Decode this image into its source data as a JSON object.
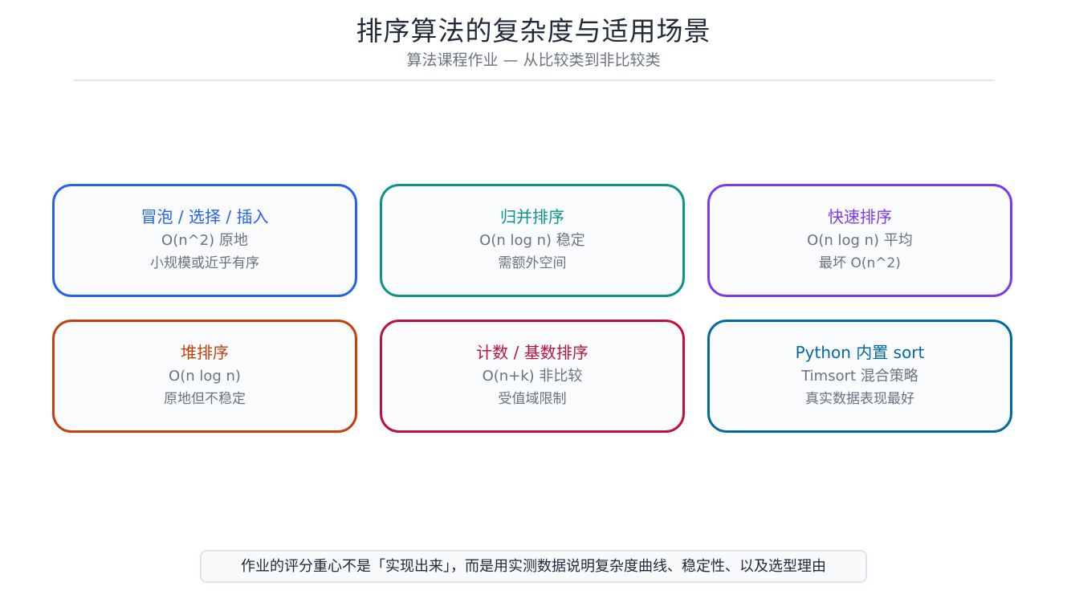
{
  "header": {
    "title": "排序算法的复杂度与适用场景",
    "subtitle": "算法课程作业 — 从比较类到非比较类"
  },
  "cards": [
    {
      "title": "冒泡 / 选择 / 插入",
      "line1": "O(n^2) 原地",
      "line2": "小规模或近乎有序",
      "color": "#2563eb"
    },
    {
      "title": "归并排序",
      "line1": "O(n log n) 稳定",
      "line2": "需额外空间",
      "color": "#0d9488"
    },
    {
      "title": "快速排序",
      "line1": "O(n log n) 平均",
      "line2": "最坏 O(n^2)",
      "color": "#7c3aed"
    },
    {
      "title": "堆排序",
      "line1": "O(n log n)",
      "line2": "原地但不稳定",
      "color": "#c2410c"
    },
    {
      "title": "计数 / 基数排序",
      "line1": "O(n+k) 非比较",
      "line2": "受值域限制",
      "color": "#be123c"
    },
    {
      "title": "Python 内置 sort",
      "line1": "Timsort 混合策略",
      "line2": "真实数据表现最好",
      "color": "#0369a1"
    }
  ],
  "footer": {
    "note": "作业的评分重心不是「实现出来」，而是用实测数据说明复杂度曲线、稳定性、以及选型理由"
  }
}
